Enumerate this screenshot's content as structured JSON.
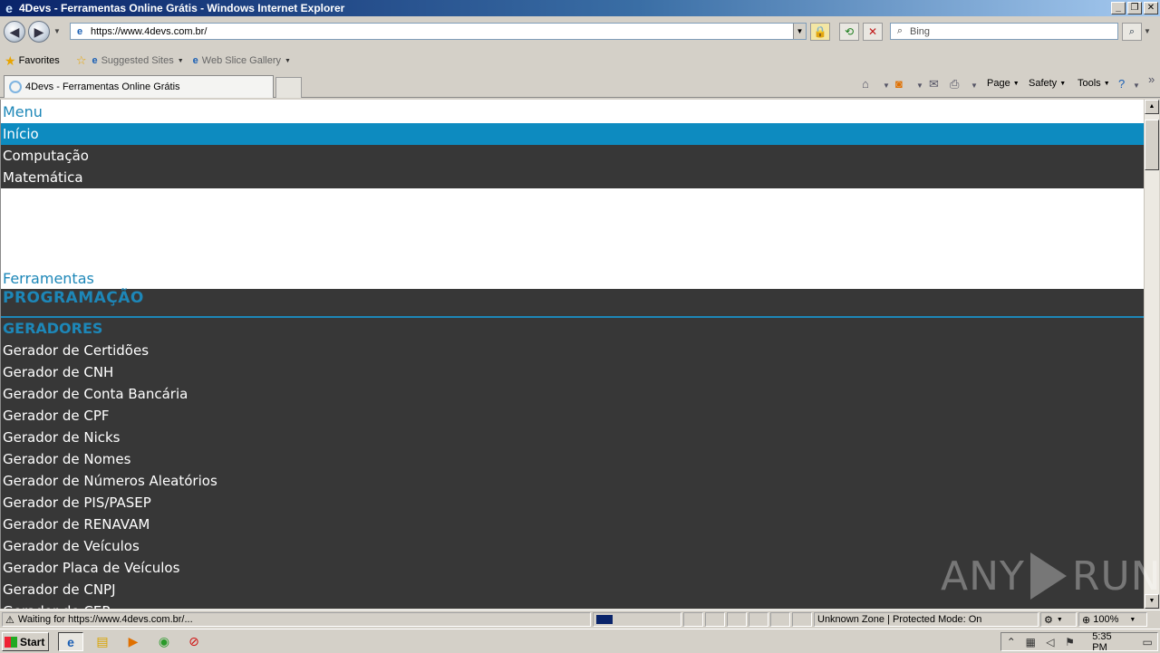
{
  "window": {
    "title": "4Devs - Ferramentas Online Grátis - Windows Internet Explorer",
    "buttons": {
      "minimize": "_",
      "maximize": "❐",
      "close": "✕"
    }
  },
  "address": {
    "url": "https://www.4devs.com.br/",
    "search_placeholder": "Bing"
  },
  "favorites": {
    "label": "Favorites",
    "items": [
      {
        "label": "Suggested Sites",
        "icon": "ie-page-icon"
      },
      {
        "label": "Web Slice Gallery",
        "icon": "ie-page-icon"
      }
    ]
  },
  "tabs": [
    {
      "label": "4Devs - Ferramentas Online Grátis"
    }
  ],
  "command_bar": {
    "page": "Page",
    "safety": "Safety",
    "tools": "Tools"
  },
  "page": {
    "menu_heading": "Menu",
    "menu_items": [
      {
        "label": "Início",
        "active": true
      },
      {
        "label": "Computação",
        "active": false
      },
      {
        "label": "Matemática",
        "active": false
      }
    ],
    "tools_heading": "Ferramentas",
    "section_heading": "PROGRAMAÇÃO",
    "subsection_heading": "GERADORES",
    "generators": [
      "Gerador de Certidões",
      "Gerador de CNH",
      "Gerador de Conta Bancária",
      "Gerador de CPF",
      "Gerador de Nicks",
      "Gerador de Nomes",
      "Gerador de Números Aleatórios",
      "Gerador de PIS/PASEP",
      "Gerador de RENAVAM",
      "Gerador de Veículos",
      "Gerador Placa de Veículos",
      "Gerador de CNPJ",
      "Gerador de CEP"
    ],
    "accent_color": "#1d87b8",
    "active_menu_color": "#0d8bc0",
    "dark_bg_color": "#373737"
  },
  "watermark": {
    "left": "ANY",
    "right": "RUN"
  },
  "statusbar": {
    "text": "Waiting for https://www.4devs.com.br/...",
    "zone": "Unknown Zone | Protected Mode: On",
    "zoom": "100%"
  },
  "taskbar": {
    "start": "Start",
    "clock": "5:35 PM"
  }
}
